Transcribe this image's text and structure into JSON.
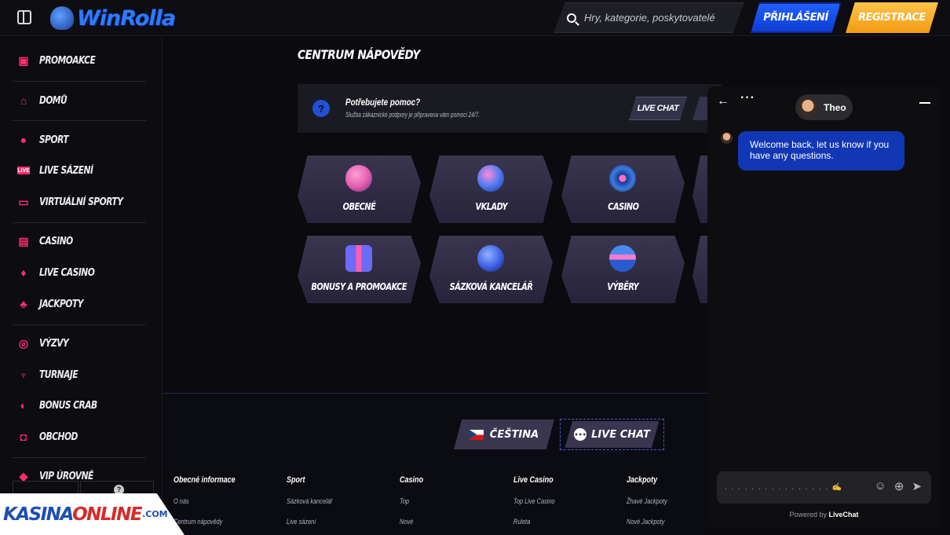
{
  "topbar": {
    "logo_text": "WinRolla",
    "search_placeholder": "Hry, kategorie, poskytovatelé",
    "login_label": "PŘIHLÁŠENÍ",
    "register_label": "REGISTRACE"
  },
  "sidebar": {
    "items": [
      {
        "label": "PROMOAKCE",
        "icon": "gift-icon"
      },
      {
        "label": "DOMŮ",
        "icon": "home-icon"
      },
      {
        "label": "SPORT",
        "icon": "ball-icon"
      },
      {
        "label": "LIVE SÁZENÍ",
        "icon": "live-icon"
      },
      {
        "label": "VIRTUÁLNÍ SPORTY",
        "icon": "virtual-icon"
      },
      {
        "label": "CASINO",
        "icon": "slot-icon"
      },
      {
        "label": "LIVE CASINO",
        "icon": "cards-icon"
      },
      {
        "label": "JACKPOTY",
        "icon": "clover-icon"
      },
      {
        "label": "VÝZVY",
        "icon": "target-icon"
      },
      {
        "label": "TURNAJE",
        "icon": "trophy-icon"
      },
      {
        "label": "BONUS CRAB",
        "icon": "crab-icon"
      },
      {
        "label": "OBCHOD",
        "icon": "bag-icon"
      },
      {
        "label": "VIP ÚROVNĚ",
        "icon": "diamond-icon"
      }
    ]
  },
  "main": {
    "title": "CENTRUM NÁPOVĚDY",
    "help_title": "Potřebujete pomoc?",
    "help_subtitle": "Služba zákaznické podpory je připravena vám pomoci 24/7.",
    "help_livechat": "LIVE CHAT",
    "categories": [
      {
        "label": "OBECNÉ",
        "color": "#e05cae"
      },
      {
        "label": "VKLADY",
        "color": "#4f7cf5"
      },
      {
        "label": "CASINO",
        "color": "#3b7be0"
      },
      {
        "label": "BONUSY A PROMOAKCE",
        "color": "#6b6bf5"
      },
      {
        "label": "SÁZKOVÁ KANCELÁŘ",
        "color": "#3c5ee6"
      },
      {
        "label": "VÝBĚRY",
        "color": "#4a8af0"
      }
    ]
  },
  "footer": {
    "language": "ČEŠTINA",
    "live_chat": "LIVE CHAT",
    "columns": [
      {
        "head": "Obecné informace",
        "links": [
          "O nás",
          "Centrum nápovědy"
        ]
      },
      {
        "head": "Sport",
        "links": [
          "Sázková kancelář",
          "Live sázení"
        ]
      },
      {
        "head": "Casino",
        "links": [
          "Top",
          "Nové"
        ]
      },
      {
        "head": "Live Casino",
        "links": [
          "Top Live Casino",
          "Ruleta"
        ]
      },
      {
        "head": "Jackpoty",
        "links": [
          "Žhavé Jackpoty",
          "Nové Jackpoty"
        ]
      }
    ]
  },
  "chat": {
    "agent_name": "Theo",
    "message": "Welcome back, let us know if you have any questions.",
    "powered_prefix": "Powered by",
    "powered_brand": "LiveChat"
  },
  "watermark": {
    "text_a": "KASINA",
    "text_b": "ONLINE",
    "text_c": ".COM"
  }
}
